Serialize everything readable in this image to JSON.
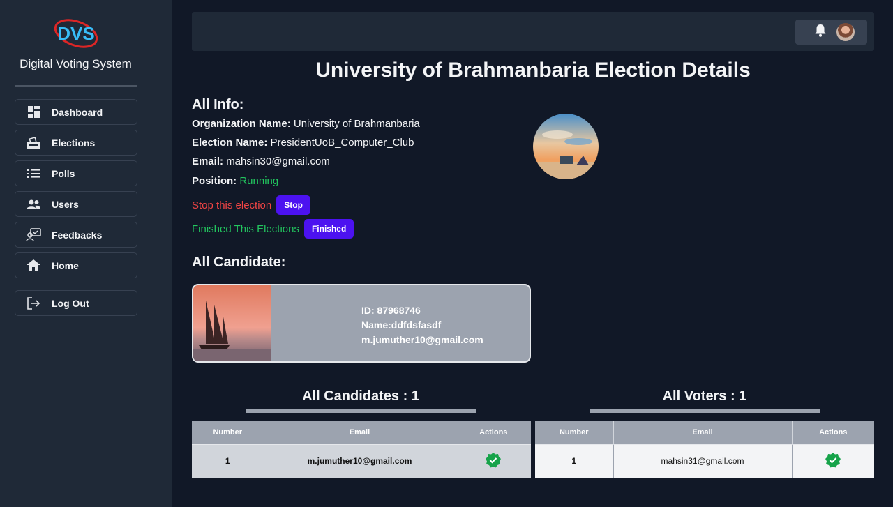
{
  "sidebar": {
    "logo_text": "DVS",
    "brand": "Digital Voting System",
    "items": [
      {
        "label": "Dashboard",
        "icon": "dashboard-icon"
      },
      {
        "label": "Elections",
        "icon": "ballot-box-icon"
      },
      {
        "label": "Polls",
        "icon": "list-icon"
      },
      {
        "label": "Users",
        "icon": "users-icon"
      },
      {
        "label": "Feedbacks",
        "icon": "feedback-icon"
      },
      {
        "label": "Home",
        "icon": "home-icon"
      },
      {
        "label": "Log Out",
        "icon": "logout-icon"
      }
    ]
  },
  "header": {
    "bell_icon": "bell-icon",
    "avatar": "user-avatar"
  },
  "page_title": "University of Brahmanbaria Election Details",
  "info": {
    "heading": "All Info:",
    "org_label": "Organization Name:",
    "org_value": "University of Brahmanbaria",
    "election_label": "Election Name:",
    "election_value": "PresidentUoB_Computer_Club",
    "email_label": "Email:",
    "email_value": "mahsin30@gmail.com",
    "position_label": "Position:",
    "position_value": "Running",
    "stop_text": "Stop this election",
    "stop_button": "Stop",
    "finish_text": "Finished This Elections",
    "finish_button": "Finished"
  },
  "candidates_heading": "All Candidate:",
  "candidate": {
    "id": "ID: 87968746",
    "name": "Name:ddfdsfasdf",
    "email": "m.jumuther10@gmail.com"
  },
  "candidates_table": {
    "title": "All Candidates : 1",
    "headers": [
      "Number",
      "Email",
      "Actions"
    ],
    "rows": [
      {
        "number": "1",
        "email": "m.jumuther10@gmail.com"
      }
    ]
  },
  "voters_table": {
    "title": "All Voters : 1",
    "headers": [
      "Number",
      "Email",
      "Actions"
    ],
    "rows": [
      {
        "number": "1",
        "email": "mahsin31@gmail.com"
      }
    ]
  },
  "colors": {
    "accent": "#4c12f0",
    "running": "#22c55e",
    "danger": "#ef4444",
    "check": "#16a34a"
  }
}
